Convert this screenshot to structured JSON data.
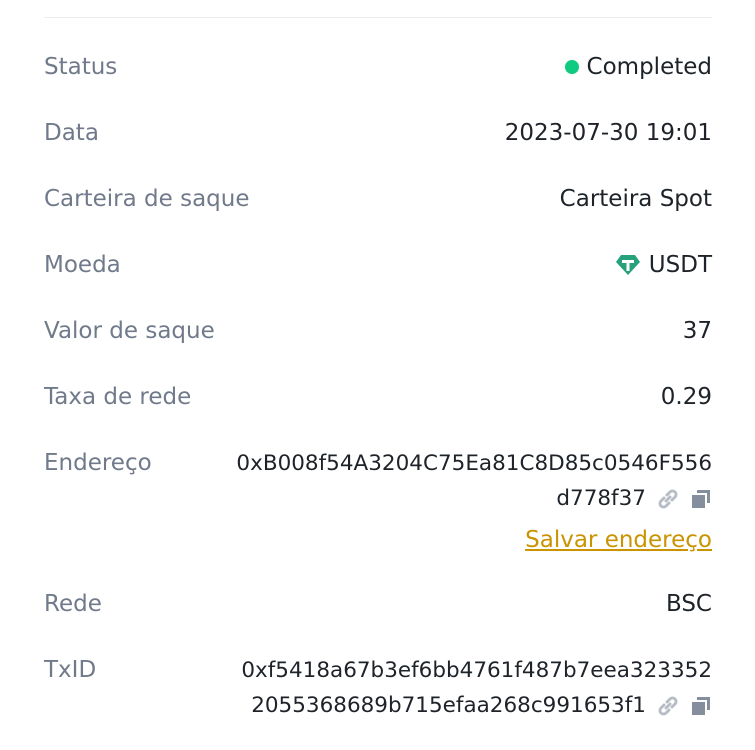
{
  "details": {
    "status": {
      "label": "Status",
      "value": "Completed",
      "color": "#0ecb81"
    },
    "date": {
      "label": "Data",
      "value": "2023-07-30 19:01"
    },
    "wallet": {
      "label": "Carteira de saque",
      "value": "Carteira Spot"
    },
    "coin": {
      "label": "Moeda",
      "value": "USDT",
      "icon": "tether-icon",
      "icon_color": "#26a17b"
    },
    "amount": {
      "label": "Valor de saque",
      "value": "37"
    },
    "fee": {
      "label": "Taxa de rede",
      "value": "0.29"
    },
    "address": {
      "label": "Endereço",
      "line1": "0xB008f54A3204C75Ea81C8D85c0546F556",
      "line2": "d778f37",
      "save_label": "Salvar endereço"
    },
    "network": {
      "label": "Rede",
      "value": "BSC"
    },
    "txid": {
      "label": "TxID",
      "line1": "0xf5418a67b3ef6bb4761f487b7eea323352",
      "line2": "2055368689b715efaa268c991653f1"
    }
  }
}
